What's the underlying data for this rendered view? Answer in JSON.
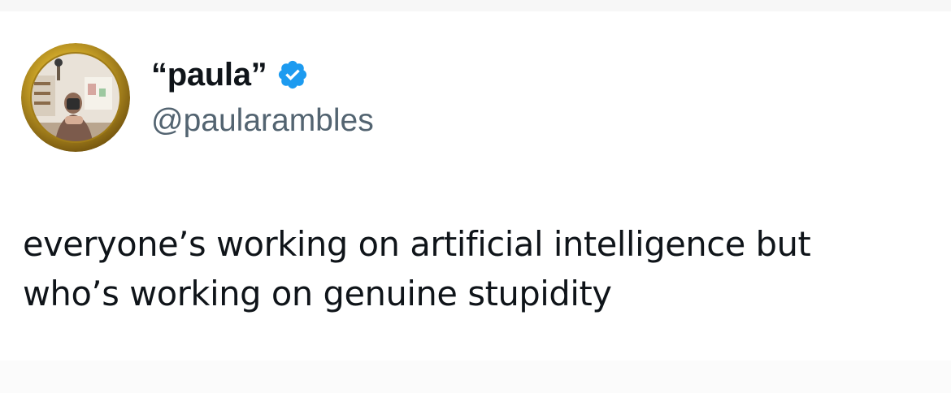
{
  "tweet": {
    "author": {
      "display_name": "“paula”",
      "handle": "@paularambles",
      "verified": true,
      "avatar_icon": "profile-photo-mirror-selfie"
    },
    "text_lines": [
      "everyone’s working on artificial intelligence but",
      "who’s working on genuine stupidity"
    ]
  },
  "colors": {
    "text_primary": "#0f1419",
    "text_secondary": "#536471",
    "verified_badge": "#1d9bf0",
    "avatar_frame_gold": "#c9a227"
  }
}
